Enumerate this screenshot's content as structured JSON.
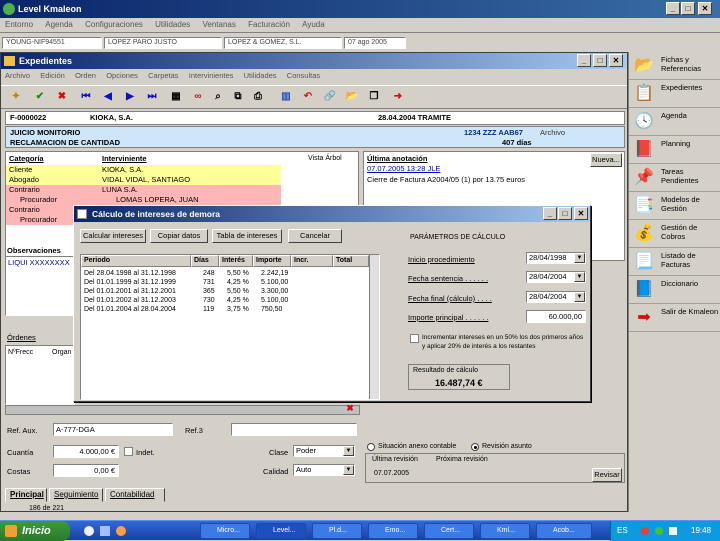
{
  "app": {
    "title": "Level Kmaleon",
    "menu": [
      "Entorno",
      "Agenda",
      "Configuraciones",
      "Utilidades",
      "Ventanas",
      "Facturación",
      "Ayuda"
    ],
    "info": [
      "YOUNG-NIF94551",
      "LOPEZ PARO JUSTO",
      "LOPEZ & GOMEZ, S.L.",
      "07 ago 2005"
    ]
  },
  "expedientes": {
    "title": "Expedientes",
    "menu": [
      "Archivo",
      "Edición",
      "Orden",
      "Opciones",
      "Carpetas",
      "Intervinientes",
      "Utilidades",
      "Consultas"
    ],
    "code": "F-0000022",
    "client_name": "KIOKA, S.A.",
    "date_state": "28.04.2004   TRAMITE",
    "type": "JUICIO MONITORIO",
    "subtype": "RECLAMACION DE CANTIDAD",
    "ref": "1234 ZZZ AAB67",
    "days": "407 días",
    "archive_label": "Archivo",
    "col_category": "Categoría",
    "col_interviniente": "Interviniente",
    "tree_view": "Vista Árbol",
    "parties": [
      {
        "cat": "Cliente",
        "name": "KIOKA, S.A."
      },
      {
        "cat": "Abogado",
        "name": "VIDAL VIDAL, SANTIAGO"
      },
      {
        "cat": "Contrario",
        "name": "LUNA S.A."
      },
      {
        "cat": "Procurador",
        "name": "LOMAS LOPERA, JUAN"
      },
      {
        "cat": "Contrario",
        "name": ""
      },
      {
        "cat": "Procurador",
        "name": ""
      }
    ],
    "last_note_label": "Última anotación",
    "last_note_date": "07.07.2005  13:28 JLE",
    "last_note_text": "Cierre de Factura A2004/05 (1) por 13.75 euros",
    "new_button": "Nueva...",
    "obs_label": "Observaciones",
    "obs_text": "LIQUI XXXXXXXX",
    "sub_tab": "Órdenes",
    "col_nfrec": "NºFrecc",
    "col_org": "Organ",
    "ref_aux_label": "Ref. Aux.",
    "ref_aux_value": "A-777-DGA",
    "ref3_label": "Ref.3",
    "cuantia_label": "Cuantía",
    "cuantia_value": "4.000,00 €",
    "indet_label": "Indet.",
    "costas_label": "Costas",
    "costas_value": "0,00 €",
    "clase_label": "Clase",
    "clase_value": "Poder",
    "calidad_label": "Calidad",
    "calidad_value": "Auto",
    "radio1": "Situación anexo contable",
    "radio2": "Revisión asunto",
    "rev_label": "Última revisión",
    "rev_date": "07.07.2005",
    "prox_label": "Próxima revisión",
    "revisar": "Revisar",
    "tabs": [
      "Principal",
      "Seguimiento",
      "Contabilidad"
    ],
    "status": "186 de 221"
  },
  "dialog": {
    "title": "Cálculo de intereses de demora",
    "buttons": [
      "Calcular intereses",
      "Copiar datos",
      "Tabla de intereses",
      "Cancelar"
    ],
    "columns": [
      "Periodo",
      "Días",
      "Interés",
      "Importe",
      "Incr.",
      "Total"
    ],
    "rows": [
      [
        "Del 28.04.1998 al 31.12.1998",
        "248",
        "5,50 %",
        "2.242,19"
      ],
      [
        "Del 01.01.1999 al 31.12.1999",
        "731",
        "4,25 %",
        "5.100,00"
      ],
      [
        "Del 01.01.2001 al 31.12.2001",
        "365",
        "5,50 %",
        "3.300,00"
      ],
      [
        "Del 01.01.2002 al 31.12.2003",
        "730",
        "4,25 %",
        "5.100,00"
      ],
      [
        "Del 01.01.2004 al 28.04.2004",
        "119",
        "3,75 %",
        "750,50"
      ]
    ],
    "params_label": "PARÁMETROS DE CÁLCULO",
    "fields": [
      {
        "label": "Inicio procedimiento",
        "value": "28/04/1998"
      },
      {
        "label": "Fecha sentencia  . . . . . .",
        "value": "28/04/2004"
      },
      {
        "label": "Fecha final (cálculo)  . . . .",
        "value": "28/04/2004"
      },
      {
        "label": "Importe principal  . . . . . .",
        "value": "60.000,00"
      }
    ],
    "checkbox_text": "Incrementar intereses en un 50% los dos primeros años y aplicar 20% de interés a los restantes",
    "result_label": "Resultado de cálculo",
    "result_value": "16.487,74 €"
  },
  "sidebar": [
    {
      "icon": "📂",
      "label": "Fichas y Referencias"
    },
    {
      "icon": "📋",
      "label": "Expedientes"
    },
    {
      "icon": "🕓",
      "label": "Agenda"
    },
    {
      "icon": "📕",
      "label": "Planning"
    },
    {
      "icon": "📌",
      "label": "Tareas Pendientes"
    },
    {
      "icon": "📑",
      "label": "Modelos de Gestión"
    },
    {
      "icon": "💰",
      "label": "Gestión de Cobros"
    },
    {
      "icon": "📃",
      "label": "Listado de Facturas"
    },
    {
      "icon": "📘",
      "label": "Diccionario"
    },
    {
      "icon": "➡",
      "label": "Salir de Kmaleon"
    }
  ],
  "taskbar": {
    "start": "Inicio",
    "tasks": [
      "Micro...",
      "Level...",
      "Pl.d...",
      "Emo...",
      "Cert...",
      "Kml...",
      "Acob..."
    ],
    "lang": "ES",
    "clock": "19:48"
  },
  "colors": {
    "yellow": "#ffff99",
    "pink": "#ffb6b6",
    "lightblue": "#cfe6f8",
    "title": "#0a246a"
  }
}
